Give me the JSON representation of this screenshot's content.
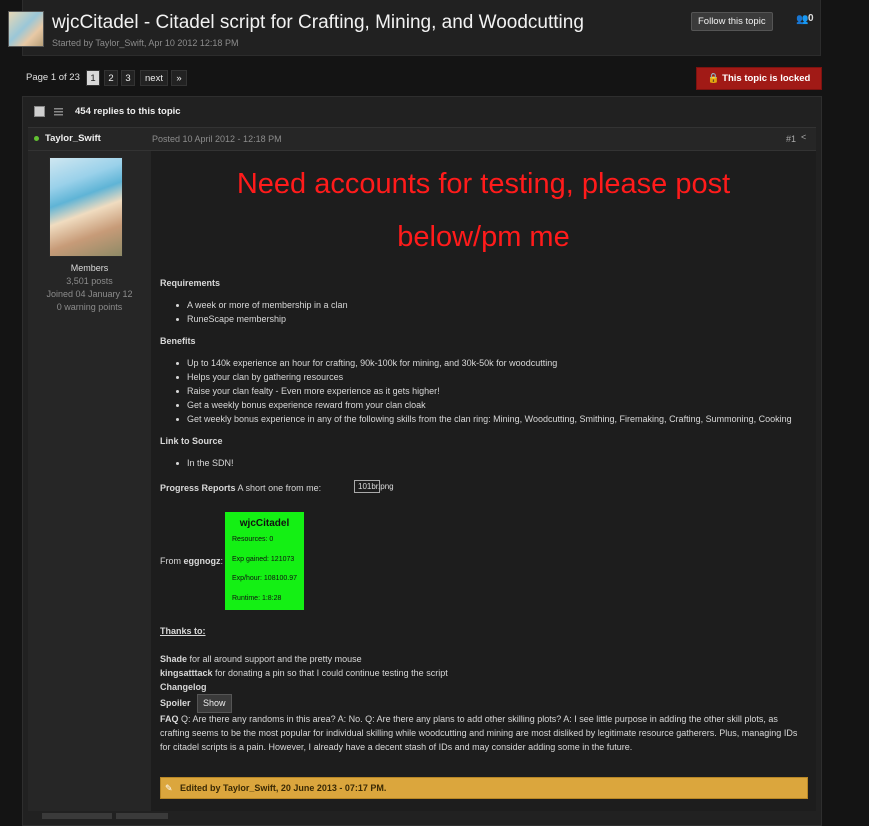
{
  "topic": {
    "title": "wjcCitadel - Citadel script for Crafting, Mining, and Woodcutting",
    "meta": "Started by Taylor_Swift, Apr 10 2012 12:18 PM",
    "follow_label": "Follow this topic",
    "follow_count": "0"
  },
  "pagination": {
    "page_of": "Page 1 of 23",
    "pages": [
      "1",
      "2",
      "3"
    ],
    "next": "next",
    "last": "»"
  },
  "locked_label": "This topic is locked",
  "replies": "454 replies to this topic",
  "post": {
    "author": "Taylor_Swift",
    "posted": "Posted 10 April 2012 - 12:18 PM",
    "number": "#1",
    "author_group": "Members",
    "author_posts": "3,501 posts",
    "author_joined": "Joined 04 January 12",
    "author_warnings": "0 warning points",
    "banner_line1": "Need accounts for testing, please post",
    "banner_line2": "below/pm me",
    "requirements_heading": "Requirements",
    "requirements": [
      "A week or more of membership in a clan",
      "RuneScape membership"
    ],
    "benefits_heading": "Benefits",
    "benefits": [
      "Up to 140k experience an hour for crafting, 90k-100k for mining, and 30k-50k for woodcutting",
      "Helps your clan by gathering resources",
      "Raise your clan fealty - Even more experience as it gets higher!",
      "Get a weekly bonus experience reward from your clan cloak",
      "Get weekly bonus experience in any of the following skills from the clan ring: Mining, Woodcutting, Smithing, Firemaking, Crafting, Summoning, Cooking"
    ],
    "source_heading": "Link to Source",
    "source_items": [
      "In the SDN!"
    ],
    "progress_heading": "Progress Reports",
    "progress_text": "A short one from me:",
    "broken_image_alt": "101br.png",
    "from_label": "From",
    "from_user": "eggnogz",
    "from_colon": ":",
    "proggy": {
      "title": "wjcCitadel",
      "resources": "Resources: 0",
      "exp_gained": "Exp gained: 121073",
      "exp_hour": "Exp/hour: 108100.97",
      "runtime": "Runtime: 1:8:28"
    },
    "thanks_heading": "Thanks to:",
    "thanks1_name": "Shade",
    "thanks1_text": "for all around support and the pretty mouse",
    "thanks2_name": "kingsatttack",
    "thanks2_text": "for donating a pin so that I could continue testing the script",
    "changelog": "Changelog",
    "spoiler": "Spoiler",
    "show_button": "Show",
    "faq_label": "FAQ",
    "faq_text": "Q: Are there any randoms in this area? A: No. Q: Are there any plans to add other skilling plots? A: I see little purpose in adding the other skill plots, as crafting seems to be the most popular for individual skilling while woodcutting and mining are most disliked by legitimate resource gatherers. Plus, managing IDs for citadel scripts is a pain. However, I already have a decent stash of IDs and may consider adding some in the future.",
    "edited": "Edited by Taylor_Swift, 20 June 2013 - 07:17 PM."
  },
  "colors": {
    "banner": "#ff1b1b",
    "locked": "#a11a16",
    "proggy_bg": "#14f014",
    "edited_bar": "#dba63d",
    "online": "#62c132"
  }
}
